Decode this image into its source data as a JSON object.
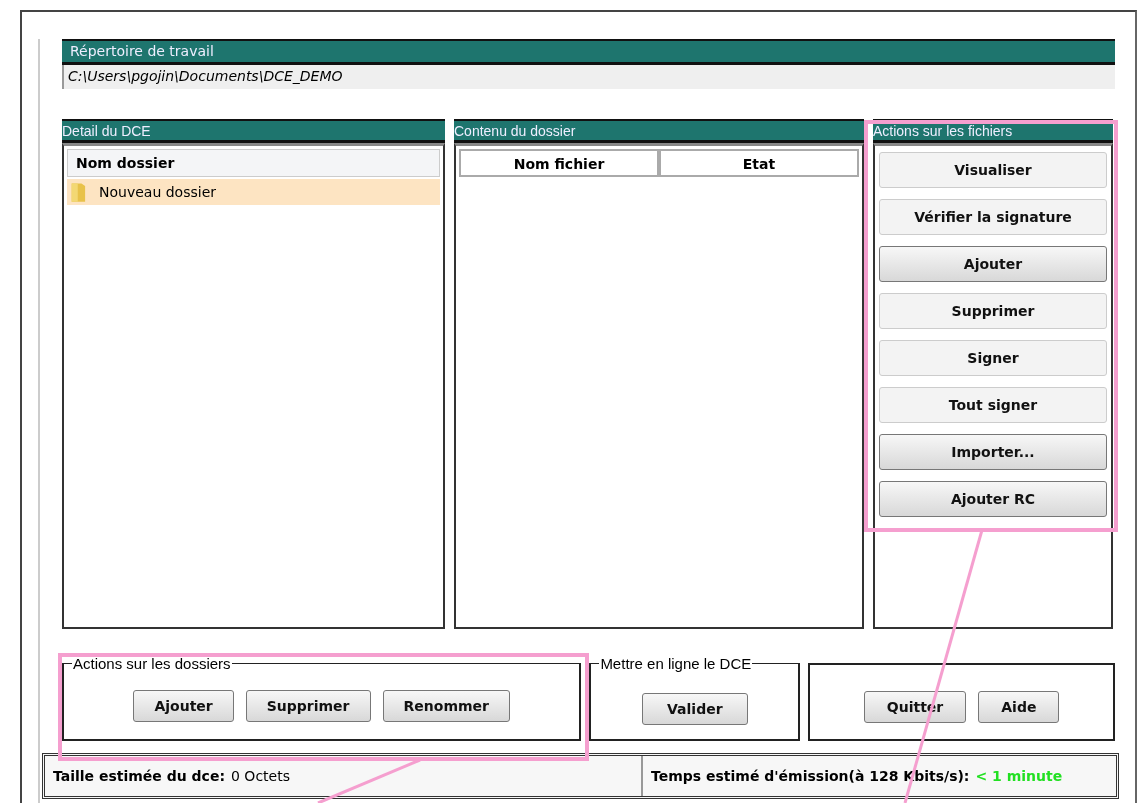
{
  "working_dir": {
    "title": "Répertoire de travail",
    "path": "C:\\Users\\pgojin\\Documents\\DCE_DEMO"
  },
  "dce_detail": {
    "title": "Detail du DCE",
    "column": "Nom dossier",
    "rows": [
      {
        "name": "Nouveau dossier",
        "selected": true
      }
    ]
  },
  "folder_content": {
    "title": "Contenu du dossier",
    "columns": [
      "Nom fichier",
      "Etat"
    ]
  },
  "file_actions": {
    "title": "Actions sur les fichiers",
    "buttons": [
      {
        "label": "Visualiser",
        "kind": "flat"
      },
      {
        "label": "Vérifier la signature",
        "kind": "flat"
      },
      {
        "label": "Ajouter",
        "kind": "raised"
      },
      {
        "label": "Supprimer",
        "kind": "flat"
      },
      {
        "label": "Signer",
        "kind": "flat"
      },
      {
        "label": "Tout signer",
        "kind": "flat"
      },
      {
        "label": "Importer...",
        "kind": "raised"
      },
      {
        "label": "Ajouter RC",
        "kind": "raised"
      }
    ]
  },
  "folder_actions": {
    "title": "Actions sur les dossiers",
    "buttons": [
      "Ajouter",
      "Supprimer",
      "Renommer"
    ]
  },
  "publish": {
    "title": "Mettre en ligne le DCE",
    "buttons": [
      "Valider"
    ]
  },
  "app_buttons": [
    "Quitter",
    "Aide"
  ],
  "status_bar": {
    "size_label": "Taille estimée du dce:",
    "size_value": "0 Octets",
    "time_label": "Temps estimé d'émission(à 128 Kbits/s):",
    "time_value": "< 1 minute"
  }
}
